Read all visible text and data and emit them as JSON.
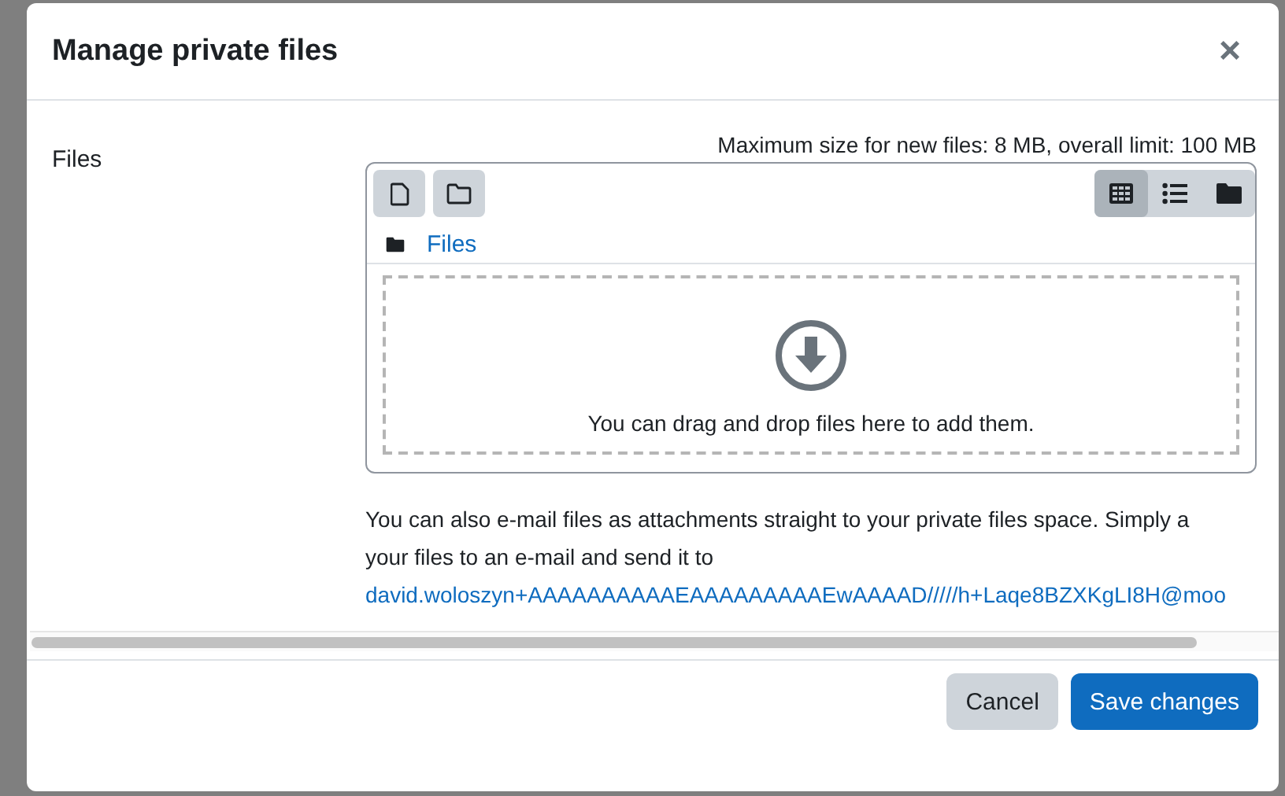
{
  "dialog": {
    "title": "Manage private files",
    "close": "×"
  },
  "field_label": "Files",
  "limits": "Maximum size for new files: 8 MB, overall limit: 100 MB",
  "toolbar": {
    "actions": [
      {
        "kind": "file"
      },
      {
        "kind": "folder"
      }
    ],
    "views": [
      {
        "kind": "grid",
        "selected": true
      },
      {
        "kind": "list",
        "selected": false
      },
      {
        "kind": "tree",
        "selected": false
      }
    ]
  },
  "breadcrumb": "Files",
  "dropzone": "You can drag and drop files here to add them.",
  "email_note": {
    "lines": [
      "You can also e-mail files as attachments straight to your private files space. Simply a",
      "your files to an e-mail and send it to"
    ],
    "address": "david.woloszyn+AAAAAAAAAAEAAAAAAAAAEwAAAAD/////h+Laqe8BZXKgLI8H@moo"
  },
  "buttons": [
    {
      "label": "Cancel",
      "kind": "secondary"
    },
    {
      "label": "Save changes",
      "kind": "primary"
    }
  ]
}
